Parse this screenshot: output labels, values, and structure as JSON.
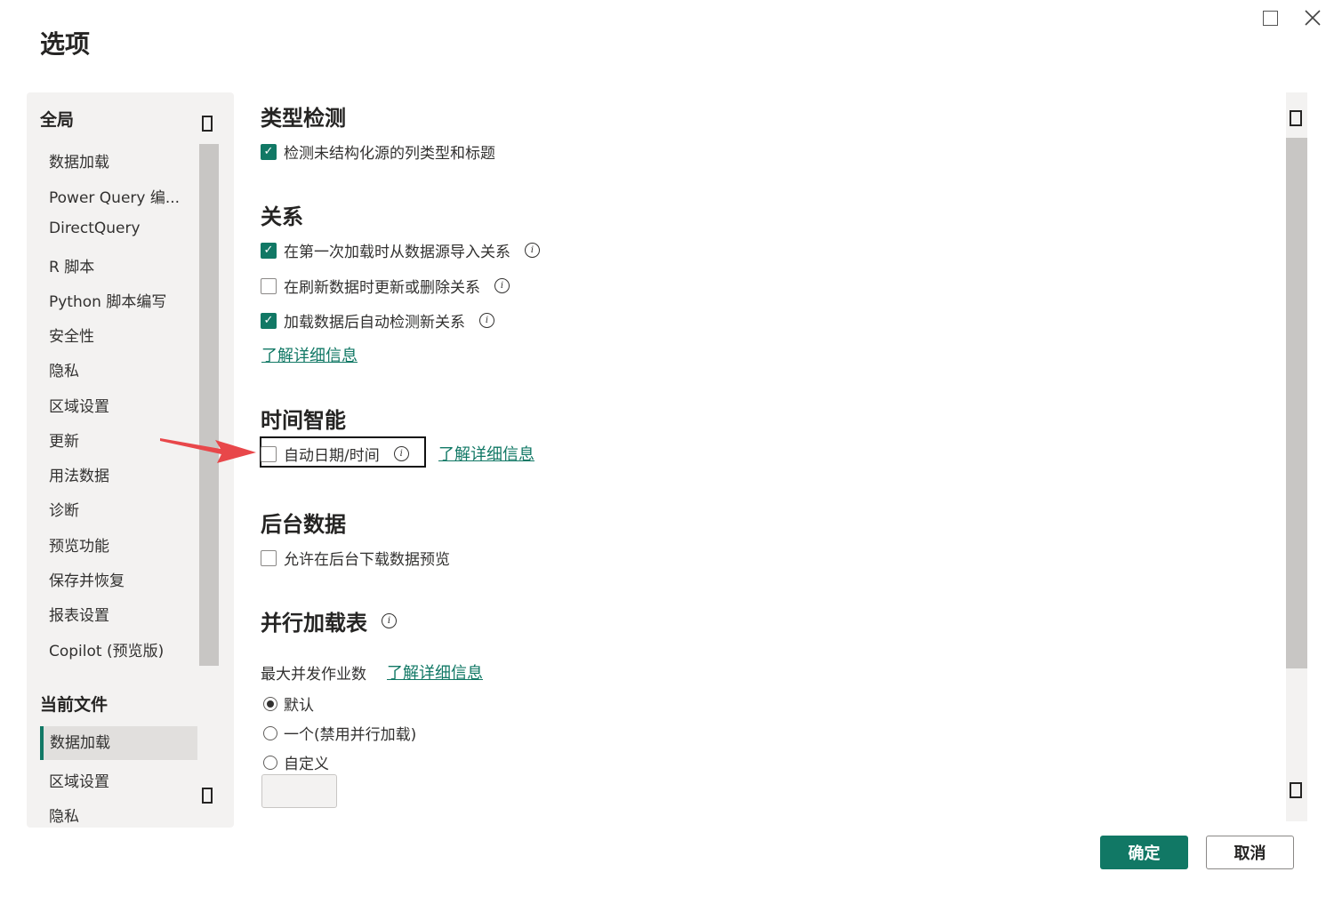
{
  "dialog": {
    "title": "选项"
  },
  "nav": {
    "global_header": "全局",
    "global_items": [
      "数据加载",
      "Power Query 编...",
      "DirectQuery",
      "R 脚本",
      "Python 脚本编写",
      "安全性",
      "隐私",
      "区域设置",
      "更新",
      "用法数据",
      "诊断",
      "预览功能",
      "保存并恢复",
      "报表设置",
      "Copilot (预览版)"
    ],
    "file_header": "当前文件",
    "file_items": [
      "数据加载",
      "区域设置",
      "隐私"
    ],
    "selected": "数据加载"
  },
  "sections": {
    "type_detection": {
      "title": "类型检测",
      "option": {
        "label": "检测未结构化源的列类型和标题",
        "checked": true
      }
    },
    "relationships": {
      "title": "关系",
      "options": [
        {
          "label": "在第一次加载时从数据源导入关系",
          "checked": true
        },
        {
          "label": "在刷新数据时更新或删除关系",
          "checked": false
        },
        {
          "label": "加载数据后自动检测新关系",
          "checked": true
        }
      ],
      "learn_more": "了解详细信息"
    },
    "time_intelligence": {
      "title": "时间智能",
      "option": {
        "label": "自动日期/时间",
        "checked": false
      },
      "learn_more": "了解详细信息"
    },
    "background_data": {
      "title": "后台数据",
      "option": {
        "label": "允许在后台下载数据预览",
        "checked": false
      }
    },
    "parallel_loading": {
      "title": "并行加载表",
      "max_jobs_label": "最大并发作业数",
      "learn_more": "了解详细信息",
      "radios": [
        {
          "label": "默认",
          "selected": true
        },
        {
          "label": "一个(禁用并行加载)",
          "selected": false
        },
        {
          "label": "自定义",
          "selected": false
        }
      ],
      "custom_value": ""
    }
  },
  "footer": {
    "ok_label": "确定",
    "cancel_label": "取消"
  },
  "colors": {
    "accent": "#117865",
    "annotation_arrow": "#e8474a"
  }
}
